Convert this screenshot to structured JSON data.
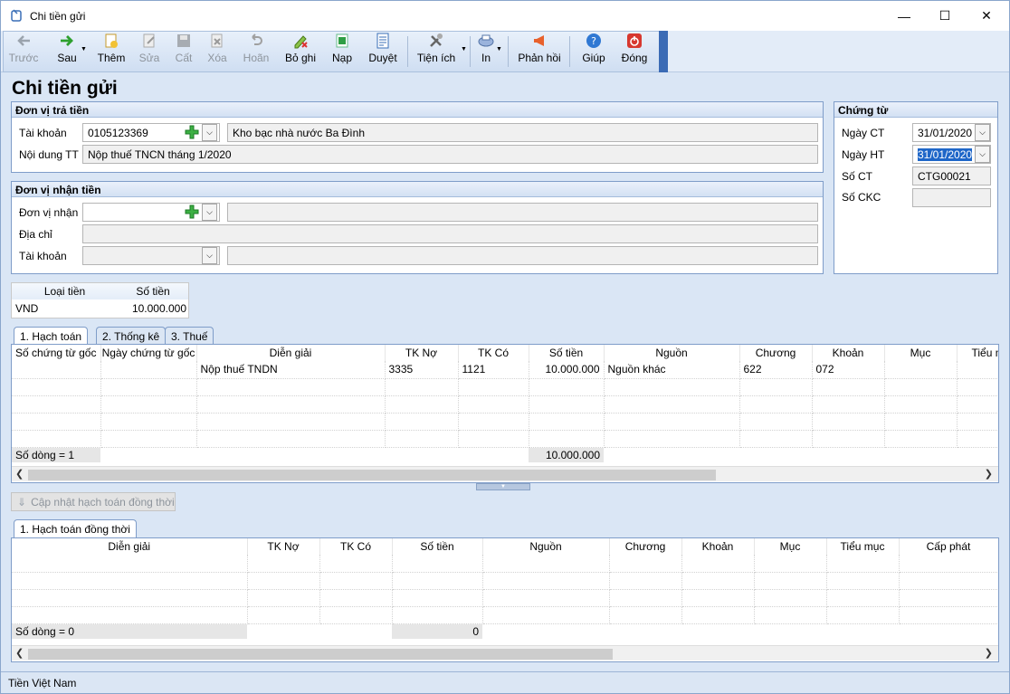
{
  "window": {
    "title": "Chi tiền gửi",
    "min": "—",
    "max": "☐",
    "close": "✕"
  },
  "toolbar": {
    "prev": "Trước",
    "next": "Sau",
    "add": "Thêm",
    "edit": "Sửa",
    "save": "Cất",
    "delete": "Xóa",
    "undo": "Hoãn",
    "unpost": "Bỏ ghi",
    "load": "Nạp",
    "approve": "Duyệt",
    "utility": "Tiện ích",
    "print": "In",
    "feedback": "Phản hồi",
    "help": "Giúp",
    "close": "Đóng"
  },
  "page_title": "Chi tiền gửi",
  "payer": {
    "header": "Đơn vị trả tiền",
    "account_label": "Tài khoản",
    "account_value": "0105123369",
    "bank_name": "Kho bạc nhà nước Ba Đình",
    "content_label": "Nội dung TT",
    "content_value": "Nộp thuế TNCN tháng 1/2020"
  },
  "payee": {
    "header": "Đơn vị nhận tiền",
    "unit_label": "Đơn vị nhận",
    "address_label": "Địa chỉ",
    "account_label": "Tài khoản"
  },
  "voucher": {
    "header": "Chứng từ",
    "date_ct_label": "Ngày CT",
    "date_ct": "31/01/2020",
    "date_ht_label": "Ngày HT",
    "date_ht": "31/01/2020",
    "so_ct_label": "Số CT",
    "so_ct": "CTG00021",
    "so_ckc_label": "Số CKC"
  },
  "currency": {
    "h1": "Loại tiền",
    "h2": "Số tiền",
    "type": "VND",
    "amount": "10.000.000"
  },
  "tabs1": [
    "1. Hạch toán",
    "2. Thống kê",
    "3. Thuế"
  ],
  "grid1": {
    "headers": [
      "Số chứng từ gốc",
      "Ngày chứng từ gốc",
      "Diễn giải",
      "TK Nợ",
      "TK Có",
      "Số tiền",
      "Nguồn",
      "Chương",
      "Khoản",
      "Mục",
      "Tiểu mục"
    ],
    "row": {
      "desc": "Nộp thuế TNDN",
      "debit": "3335",
      "credit": "1121",
      "amount": "10.000.000",
      "source": "Nguồn khác",
      "chapter": "622",
      "item": "072"
    },
    "count": "Số dòng = 1",
    "total": "10.000.000"
  },
  "update_button": "Cập nhật hạch toán đồng thời",
  "tabs2": [
    "1. Hạch toán đồng thời"
  ],
  "grid2": {
    "headers": [
      "Diễn giải",
      "TK Nợ",
      "TK Có",
      "Số tiền",
      "Nguồn",
      "Chương",
      "Khoản",
      "Mục",
      "Tiểu mục",
      "Cấp phát"
    ],
    "count": "Số dòng = 0",
    "total": "0"
  },
  "status": "Tiền Việt Nam"
}
